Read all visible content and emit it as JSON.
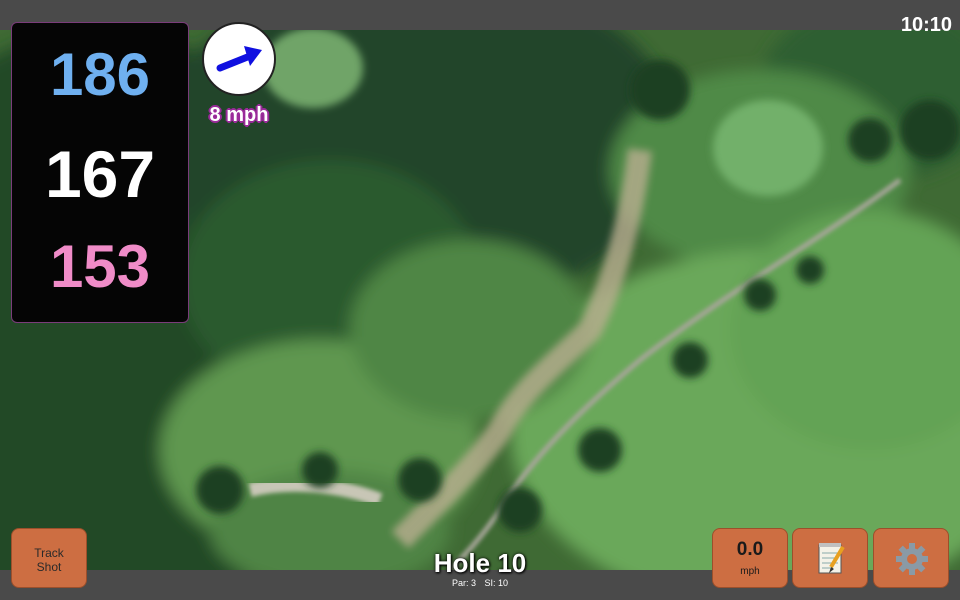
{
  "status": {
    "time": "10:10"
  },
  "yardages": {
    "back": "186",
    "middle": "167",
    "front": "153"
  },
  "colors": {
    "back": "#6fb0f0",
    "middle": "#ffffff",
    "front": "#f08cc8",
    "button": "#cd6e42",
    "wind_arrow": "#1010e0"
  },
  "wind": {
    "speed": "8 mph",
    "direction_icon": "wind-arrow-icon"
  },
  "buttons": {
    "track_line1": "Track",
    "track_line2": "Shot",
    "speed_value": "0.0",
    "speed_unit": "mph",
    "notes_icon": "notepad-icon",
    "settings_icon": "gear-icon"
  },
  "hole": {
    "title": "Hole 10",
    "par": "Par: 3",
    "si": "SI: 10"
  },
  "map": {
    "icon": "satellite-map"
  }
}
